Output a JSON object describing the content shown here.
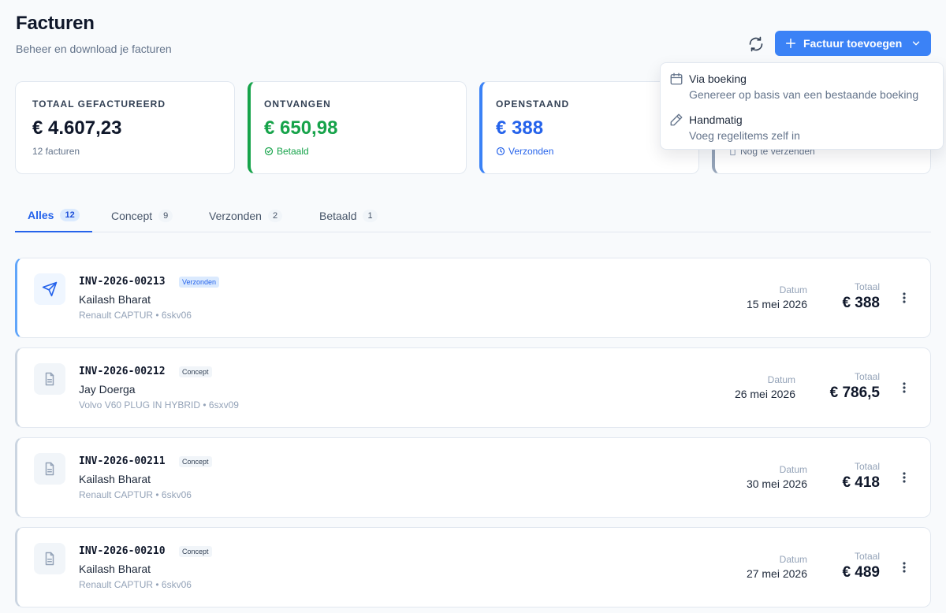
{
  "header": {
    "title": "Facturen",
    "subtitle": "Beheer en download je facturen"
  },
  "toolbar": {
    "refresh_icon": "refresh-icon",
    "add_label": "Factuur toevoegen",
    "accent": "#3b82f6"
  },
  "dropdown": {
    "items": [
      {
        "icon": "calendar-icon",
        "title": "Via boeking",
        "description": "Genereer op basis van een bestaande boeking"
      },
      {
        "icon": "pencil-icon",
        "title": "Handmatig",
        "description": "Voeg regelitems zelf in"
      }
    ]
  },
  "stats": [
    {
      "label": "TOTAAL GEFACTUREERD",
      "value": "€ 4.607,23",
      "sub": "12 facturen"
    },
    {
      "label": "ONTVANGEN",
      "value": "€ 650,98",
      "sub": "Betaald",
      "color": "#16a34a"
    },
    {
      "label": "OPENSTAAND",
      "value": "€ 388",
      "sub": "Verzonden",
      "color": "#2563eb"
    },
    {
      "label": "",
      "value": "",
      "sub": "Nog te verzenden",
      "color": "#94a3b8"
    }
  ],
  "tabs": [
    {
      "label": "Alles",
      "count": "12"
    },
    {
      "label": "Concept",
      "count": "9"
    },
    {
      "label": "Verzonden",
      "count": "2"
    },
    {
      "label": "Betaald",
      "count": "1"
    }
  ],
  "invoices": {
    "date_label": "Datum",
    "total_label": "Totaal",
    "items": [
      {
        "number": "INV-2026-00213",
        "status": "Verzonden",
        "customer": "Kailash Bharat",
        "vehicle": "Renault CAPTUR • 6skv06",
        "date": "15 mei 2026",
        "total": "€ 388"
      },
      {
        "number": "INV-2026-00212",
        "status": "Concept",
        "customer": "Jay Doerga",
        "vehicle": "Volvo V60 PLUG IN HYBRID • 6sxv09",
        "date": "26 mei 2026",
        "total": "€ 786,5"
      },
      {
        "number": "INV-2026-00211",
        "status": "Concept",
        "customer": "Kailash Bharat",
        "vehicle": "Renault CAPTUR • 6skv06",
        "date": "30 mei 2026",
        "total": "€ 418"
      },
      {
        "number": "INV-2026-00210",
        "status": "Concept",
        "customer": "Kailash Bharat",
        "vehicle": "Renault CAPTUR • 6skv06",
        "date": "27 mei 2026",
        "total": "€ 489"
      }
    ]
  }
}
